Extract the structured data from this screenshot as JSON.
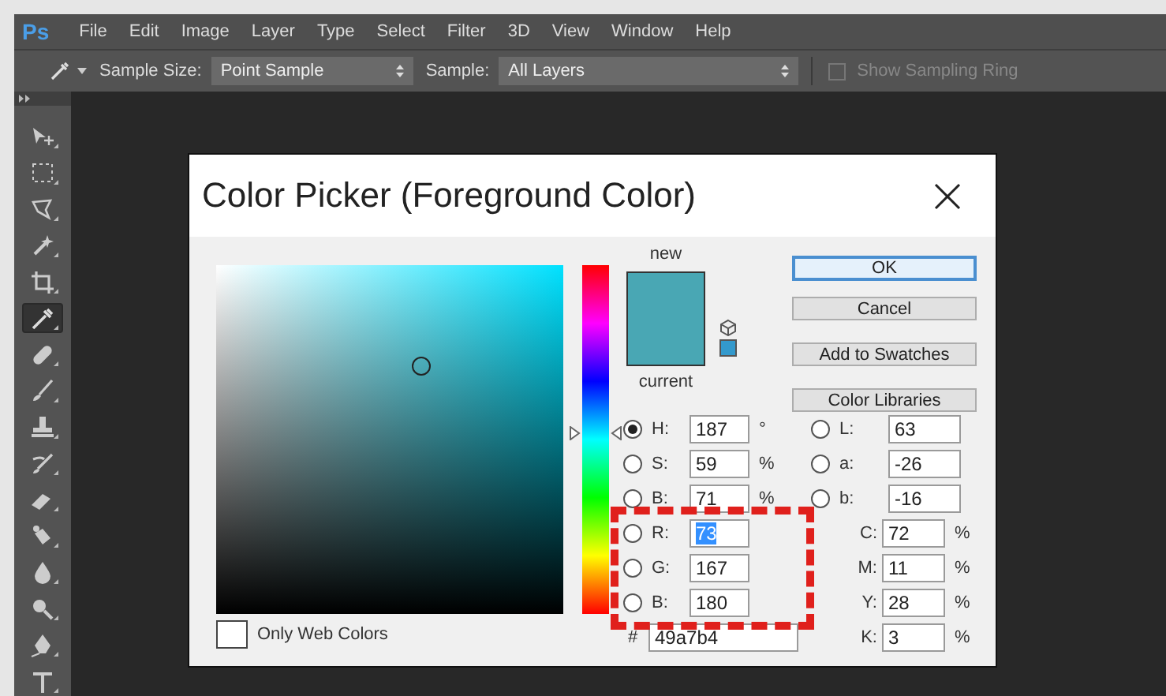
{
  "menu_bar": {
    "logo": "Ps",
    "items": [
      "File",
      "Edit",
      "Image",
      "Layer",
      "Type",
      "Select",
      "Filter",
      "3D",
      "View",
      "Window",
      "Help"
    ]
  },
  "options_bar": {
    "sample_size_label": "Sample Size:",
    "sample_size": "Point Sample",
    "sample_label": "Sample:",
    "sample": "All Layers",
    "show_sampling_ring": {
      "label": "Show Sampling Ring",
      "checked": false,
      "disabled": true
    }
  },
  "tools": [
    {
      "selected": false
    },
    {
      "selected": false
    },
    {
      "selected": false
    },
    {
      "selected": false
    },
    {
      "selected": false
    },
    {
      "selected": true
    },
    {
      "selected": false
    },
    {
      "selected": false
    },
    {
      "selected": false
    },
    {
      "selected": false
    },
    {
      "selected": false
    },
    {
      "selected": false
    },
    {
      "selected": false
    },
    {
      "selected": false
    },
    {
      "selected": false
    },
    {
      "selected": false
    }
  ],
  "dialog": {
    "title": "Color Picker (Foreground Color)",
    "new_label": "new",
    "current_label": "current",
    "hue_slider": {
      "level": 0.48
    },
    "buttons": [
      {
        "label": "OK",
        "default": true
      },
      {
        "label": "Cancel",
        "default": false
      },
      {
        "label": "Add to Swatches",
        "default": false
      },
      {
        "label": "Color Libraries",
        "default": false
      }
    ],
    "only_web_colors": {
      "label": "Only Web Colors",
      "checked": false
    },
    "hsb_rgb": [
      {
        "label": "H:",
        "value": "187",
        "unit": "°",
        "selected": true,
        "highlighted": false
      },
      {
        "label": "S:",
        "value": "59",
        "unit": "%",
        "selected": false,
        "highlighted": false
      },
      {
        "label": "B:",
        "value": "71",
        "unit": "%",
        "selected": false,
        "highlighted": false
      },
      {
        "label": "R:",
        "value": "73",
        "selected": false,
        "highlighted": true
      },
      {
        "label": "G:",
        "value": "167",
        "selected": false,
        "highlighted": false
      },
      {
        "label": "B:",
        "value": "180",
        "selected": false,
        "highlighted": false
      }
    ],
    "lab": [
      {
        "label": "L:",
        "value": "63",
        "selected": false
      },
      {
        "label": "a:",
        "value": "-26",
        "selected": false
      },
      {
        "label": "b:",
        "value": "-16",
        "selected": false
      }
    ],
    "cmyk": [
      {
        "label": "C:",
        "value": "72",
        "unit": "%"
      },
      {
        "label": "M:",
        "value": "11",
        "unit": "%"
      },
      {
        "label": "Y:",
        "value": "28",
        "unit": "%"
      },
      {
        "label": "K:",
        "value": "3",
        "unit": "%"
      }
    ],
    "hex": {
      "label": "#",
      "value": "49a7b4"
    }
  }
}
